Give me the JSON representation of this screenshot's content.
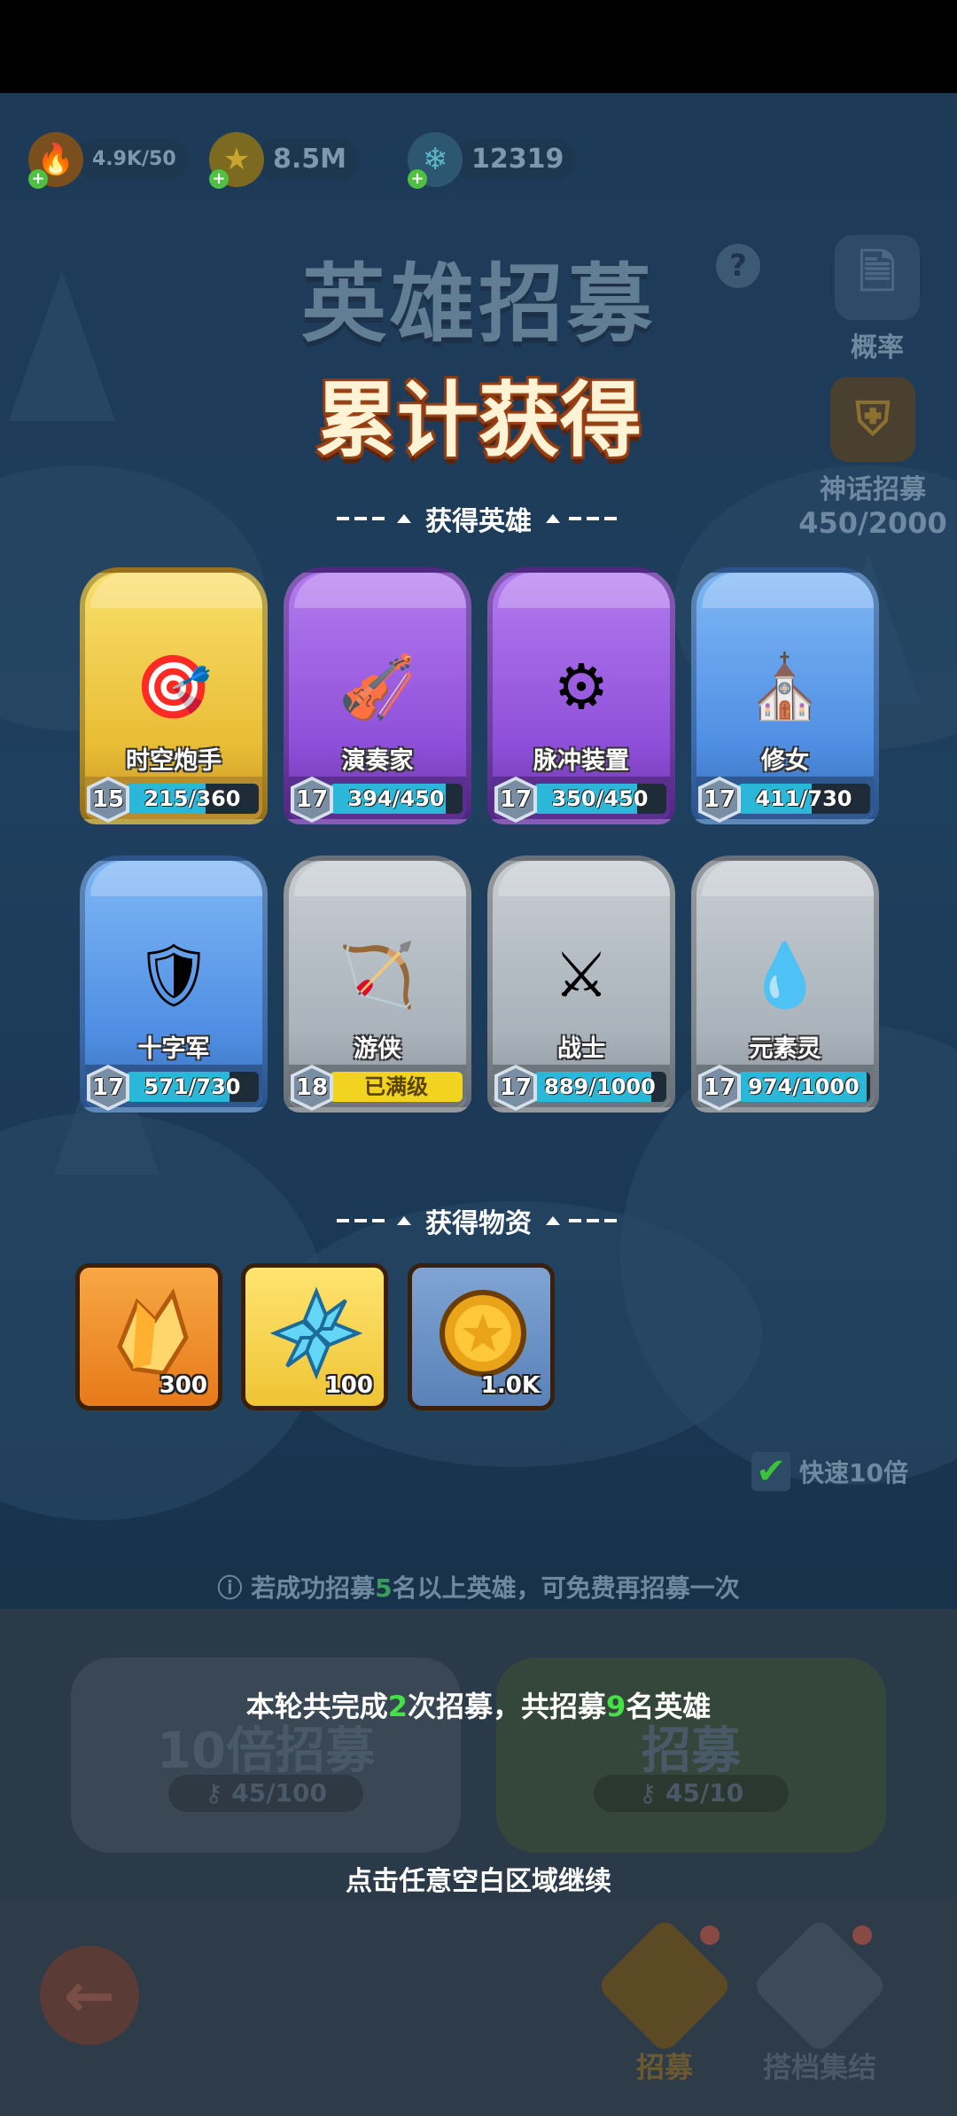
{
  "resources": [
    {
      "name": "stamina",
      "icon": "flame-icon",
      "value": "4.9K/50"
    },
    {
      "name": "gold",
      "icon": "gold-coin-icon",
      "value": "8.5M"
    },
    {
      "name": "crystal",
      "icon": "crystal-flower-icon",
      "value": "12319"
    }
  ],
  "header": {
    "title": "英雄招募",
    "cumulative_title": "累计获得"
  },
  "side": {
    "probability_label": "概率",
    "mythic_label": "神话招募",
    "mythic_progress": "450/2000"
  },
  "heroes_section": {
    "title": "获得英雄",
    "heroes": [
      {
        "name": "时空炮手",
        "level": "15",
        "progress_text": "215/360",
        "fill": 0.597,
        "rarity": "gold"
      },
      {
        "name": "演奏家",
        "level": "17",
        "progress_text": "394/450",
        "fill": 0.876,
        "rarity": "purple"
      },
      {
        "name": "脉冲装置",
        "level": "17",
        "progress_text": "350/450",
        "fill": 0.778,
        "rarity": "purple"
      },
      {
        "name": "修女",
        "level": "17",
        "progress_text": "411/730",
        "fill": 0.563,
        "rarity": "blue"
      },
      {
        "name": "十字军",
        "level": "17",
        "progress_text": "571/730",
        "fill": 0.782,
        "rarity": "blue"
      },
      {
        "name": "游侠",
        "level": "18",
        "progress_text": "已满级",
        "fill": 1,
        "rarity": "grey",
        "maxed": true
      },
      {
        "name": "战士",
        "level": "17",
        "progress_text": "889/1000",
        "fill": 0.889,
        "rarity": "grey"
      },
      {
        "name": "元素灵",
        "level": "17",
        "progress_text": "974/1000",
        "fill": 0.974,
        "rarity": "grey"
      }
    ]
  },
  "items_section": {
    "title": "获得物资",
    "items": [
      {
        "icon": "gold-crystal-icon",
        "qty": "300"
      },
      {
        "icon": "crystal-flower-icon",
        "qty": "100"
      },
      {
        "icon": "gold-coin-icon",
        "qty": "1.0K"
      }
    ]
  },
  "fast": {
    "label": "快速10倍",
    "checked": true
  },
  "info": {
    "prefix": "若成功招募",
    "num": "5",
    "suffix": "名以上英雄，可免费再招募一次"
  },
  "buttons": {
    "ten_x": {
      "num": "10",
      "label": "倍招募",
      "cost": "45/100"
    },
    "single": {
      "label": "招募",
      "cost": "45/10"
    }
  },
  "summary": {
    "p1": "本轮共完成",
    "n1": "2",
    "p2": "次招募，共招募",
    "n2": "9",
    "p3": "名英雄"
  },
  "continue_text": "点击任意空白区域继续",
  "nav": {
    "recruit": "招募",
    "partner": "搭档集结"
  },
  "colors": {
    "accent_green": "#45e045",
    "progress_fill": "#2bb8d8",
    "maxed_yellow": "#f1d320"
  }
}
